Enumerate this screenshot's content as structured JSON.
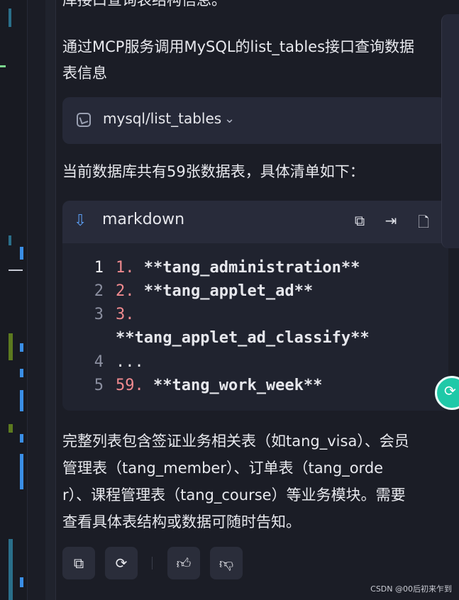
{
  "partial_top_text": "库接口查询表结构信息。",
  "intro_text": "通过MCP服务调用MySQL的list_tables接口查询数据表信息",
  "tool_call": {
    "name": "mysql/list_tables",
    "icon": "tool-icon"
  },
  "summary_text": "当前数据库共有59张数据表，具体清单如下：",
  "code_block": {
    "language": "markdown",
    "lines": [
      {
        "line_no": "1",
        "num": "1.",
        "text": " **tang_administration**"
      },
      {
        "line_no": "2",
        "num": "2.",
        "text": " **tang_applet_ad**"
      },
      {
        "line_no": "3",
        "num": "3.",
        "text": ""
      },
      {
        "line_no": "",
        "num": "",
        "text": "**tang_applet_ad_classify**"
      },
      {
        "line_no": "4",
        "num": "",
        "text": "..."
      },
      {
        "line_no": "5",
        "num": "59.",
        "text": " **tang_work_week**"
      }
    ]
  },
  "closing_text": "完整列表包含签证业务相关表（如tang_visa）、会员管理表（tang_member）、订单表（tang_order）、课程管理表（tang_course）等业务模块。需要查看具体表结构或数据可随时告知。",
  "closing_lines": [
    "完整列表包含签证业务相关表（如tang_visa）、会员",
    "管理表（tang_member）、订单表（tang_orde",
    "r）、课程管理表（tang_course）等业务模块。需要",
    "查看具体表结构或数据可随时告知。"
  ],
  "intro_lines": [
    "通过MCP服务调用MySQL的list_tables接口查询数据",
    "表信息"
  ],
  "watermark": "CSDN @00后初来乍到",
  "colors": {
    "background": "#1b1d26",
    "code_bg": "#20232f",
    "accent": "#5b9cf0",
    "number": "#f08a8f"
  }
}
